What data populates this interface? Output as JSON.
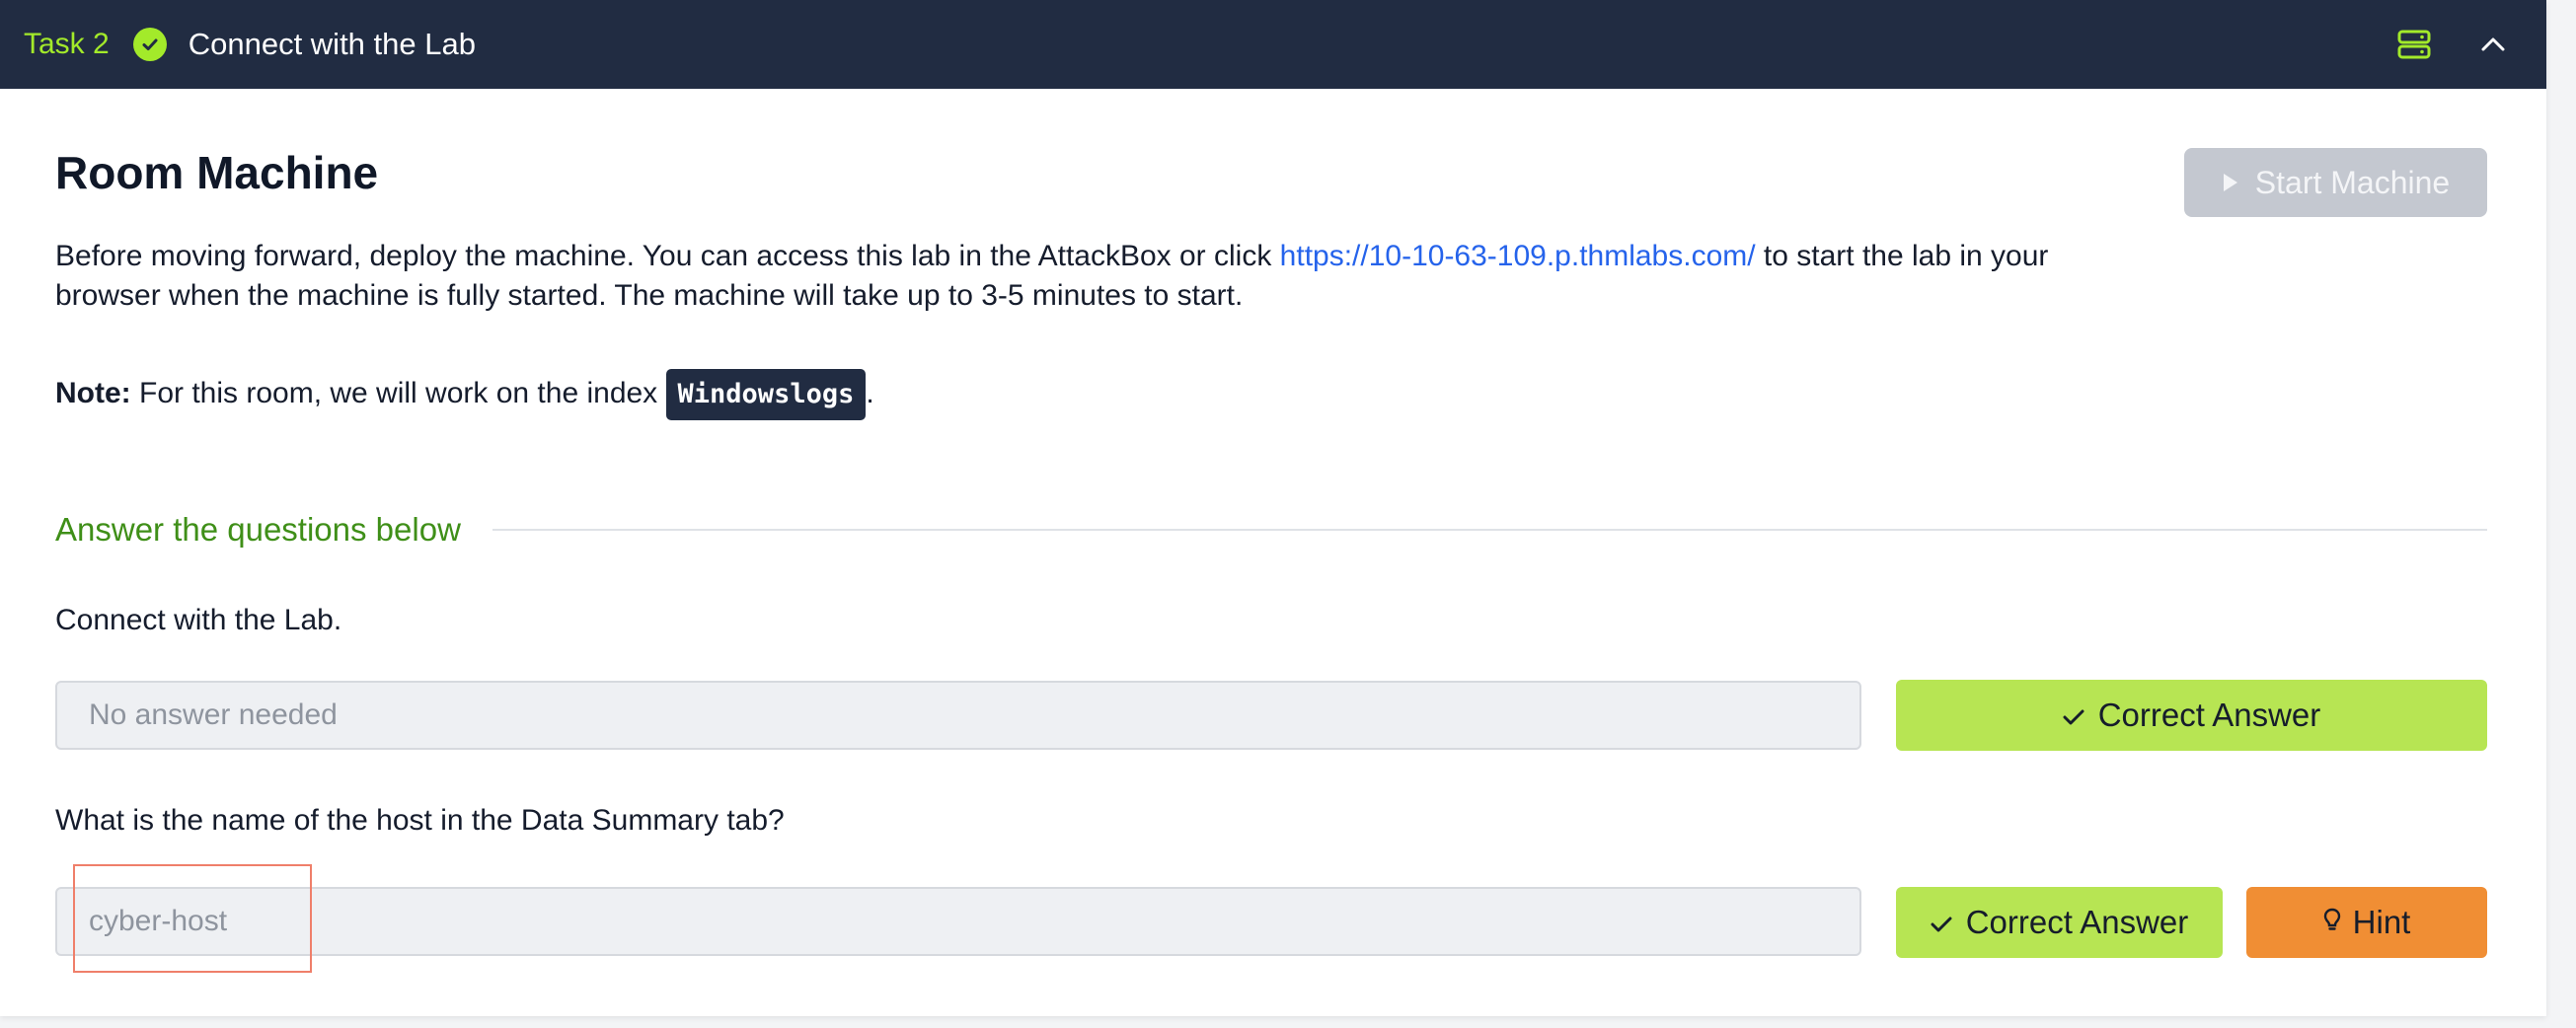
{
  "task_header": {
    "task_label": "Task 2",
    "status_icon": "check-circle-icon",
    "title": "Connect with the Lab",
    "icons": [
      "server-icon",
      "chevron-up-icon"
    ]
  },
  "machine": {
    "title": "Room Machine",
    "start_button_label": "Start Machine",
    "intro_before_link": "Before moving forward, deploy the machine. You can access this lab in the AttackBox or click ",
    "link_text": "https://10-10-63-109.p.thmlabs.com/",
    "intro_after_link": " to start the lab in your browser when the machine is fully started. The machine will take up to 3-5 minutes to start.",
    "note_label": "Note:",
    "note_text": " For this room, we will work on the index ",
    "note_code": "Windowslogs",
    "note_end": "."
  },
  "questions_section": {
    "heading": "Answer the questions below",
    "items": [
      {
        "question": "Connect with the Lab.",
        "answer": "No answer needed",
        "button_label": "Correct Answer"
      },
      {
        "question": "What is the name of the host in the Data Summary tab?",
        "answer": "cyber-host",
        "button_label": "Correct Answer",
        "hint_label": "Hint"
      }
    ]
  },
  "colors": {
    "header_bg": "#212c42",
    "accent_green": "#a3ea2a",
    "correct_button": "#b7e553",
    "hint_button": "#f08e34",
    "link": "#2563eb",
    "section_heading": "#3f8f18",
    "highlight_box": "#ef7f6a"
  }
}
